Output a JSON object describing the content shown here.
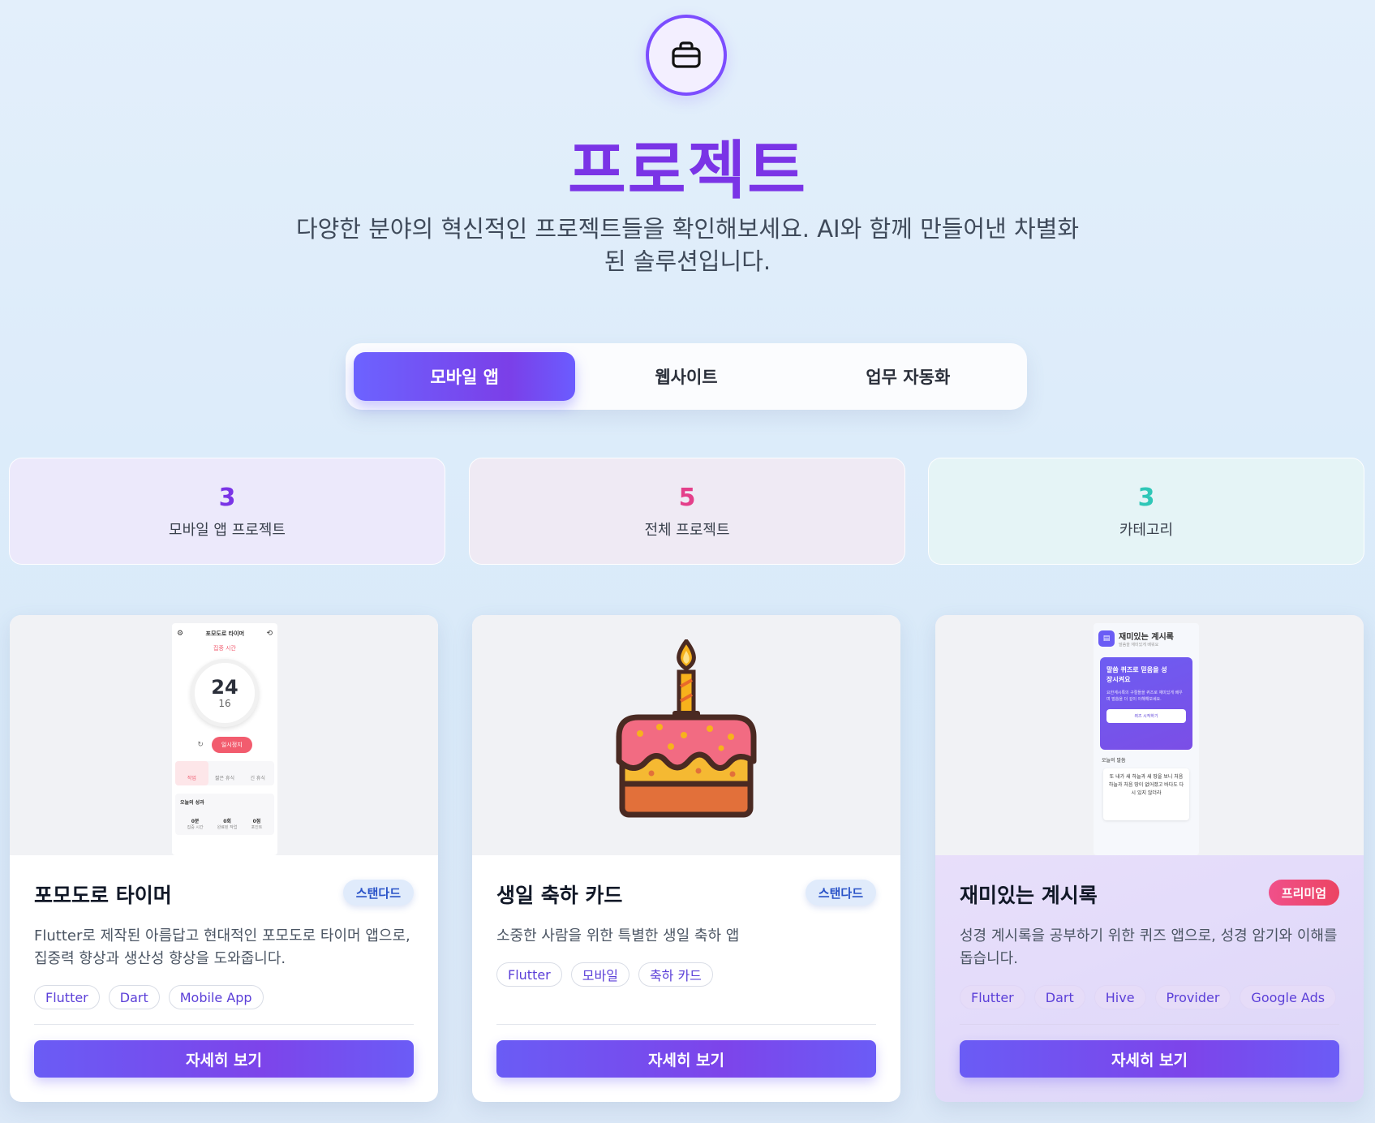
{
  "header": {
    "title": "프로젝트",
    "subtitle": "다양한 분야의 혁신적인 프로젝트들을 확인해보세요. AI와 함께 만들어낸 차별화된 솔루션입니다."
  },
  "tabs": [
    {
      "label": "모바일 앱",
      "active": true
    },
    {
      "label": "웹사이트",
      "active": false
    },
    {
      "label": "업무 자동화",
      "active": false
    }
  ],
  "stats": [
    {
      "value": "3",
      "label": "모바일 앱 프로젝트",
      "color": "#7a34e6"
    },
    {
      "value": "5",
      "label": "전체 프로젝트",
      "color": "#e43f8a"
    },
    {
      "value": "3",
      "label": "카테고리",
      "color": "#2fc7b7"
    }
  ],
  "cards": [
    {
      "title": "포모도로 타이머",
      "badge": "스탠다드",
      "description": "Flutter로 제작된 아름답고 현대적인 포모도로 타이머 앱으로, 집중력 향상과 생산성 향상을 도와줍니다.",
      "tags": [
        "Flutter",
        "Dart",
        "Mobile App"
      ],
      "button": "자세히 보기",
      "preview": {
        "app_title": "포모도로 타이머",
        "mode": "집중 시간",
        "minutes": "24",
        "seconds": "16",
        "pause": "일시정지",
        "nav": [
          "작업",
          "짧은 휴식",
          "긴 휴식"
        ],
        "stats_title": "오늘의 성과",
        "stats": [
          {
            "value": "0분",
            "label": "집중 시간"
          },
          {
            "value": "0회",
            "label": "완료된 작업"
          },
          {
            "value": "0점",
            "label": "포인트"
          }
        ]
      }
    },
    {
      "title": "생일 축하 카드",
      "badge": "스탠다드",
      "description": "소중한 사람을 위한 특별한 생일 축하 앱",
      "tags": [
        "Flutter",
        "모바일",
        "축하 카드"
      ],
      "button": "자세히 보기"
    },
    {
      "title": "재미있는 계시록",
      "badge": "프리미엄",
      "description": "성경 계시록을 공부하기 위한 퀴즈 앱으로, 성경 암기와 이해를 돕습니다.",
      "tags": [
        "Flutter",
        "Dart",
        "Hive",
        "Provider",
        "Google Ads"
      ],
      "button": "자세히 보기",
      "preview": {
        "app_title": "재미있는 계시록",
        "app_subtitle": "말씀을 재미있게 배워요",
        "banner_title": "말씀 퀴즈로 믿음을 성장시켜요",
        "banner_text": "요한계시록의 구절들을 퀴즈로 재미있게 배우며 말씀을 더 깊이 이해해보세요.",
        "start": "퀴즈 시작하기",
        "verse_title": "오늘의 말씀",
        "verse": "또 내가 새 하늘과 새 땅을 보니 처음 하늘과 처음 땅이 없어졌고 바다도 다시 있지 않더라"
      }
    }
  ]
}
